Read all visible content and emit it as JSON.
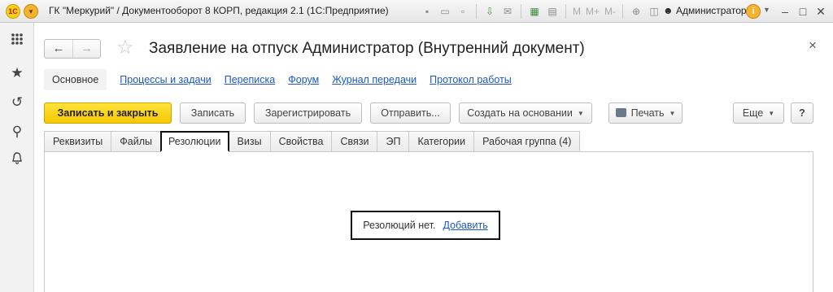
{
  "titlebar": {
    "logo": "1С",
    "title": "ГК \"Меркурий\" / Документооборот 8 КОРП, редакция 2.1  (1С:Предприятие)",
    "toolbar_m_labels": [
      "M",
      "M+",
      "M-"
    ],
    "user": "Администратор",
    "info": "i"
  },
  "sidebar": {
    "items": [
      {
        "icon": "apps-grid-icon"
      },
      {
        "icon": "star-favorites-icon"
      },
      {
        "icon": "history-icon"
      },
      {
        "icon": "search-icon"
      },
      {
        "icon": "bell-icon"
      }
    ]
  },
  "form": {
    "title": "Заявление на отпуск Администратор (Внутренний документ)",
    "close": "×",
    "nav": {
      "back": "←",
      "forward": "→"
    },
    "star": "☆"
  },
  "linkbar": {
    "active": "Основное",
    "links": [
      "Процессы и задачи",
      "Переписка",
      "Форум",
      "Журнал передачи",
      "Протокол работы"
    ]
  },
  "toolbar": {
    "save_close": "Записать и закрыть",
    "save": "Записать",
    "register": "Зарегистрировать",
    "send": "Отправить...",
    "create_based": "Создать на основании",
    "print": "Печать",
    "more": "Еще",
    "help": "?"
  },
  "tabs": [
    "Реквизиты",
    "Файлы",
    "Резолюции",
    "Визы",
    "Свойства",
    "Связи",
    "ЭП",
    "Категории",
    "Рабочая группа (4)"
  ],
  "active_tab": "Резолюции",
  "resolutions": {
    "empty_text": "Резолюций нет.",
    "add_link": "Добавить"
  },
  "colors": {
    "accent_yellow": "#f5c800",
    "link_blue": "#1a58c4",
    "highlight_border": "#111111"
  }
}
